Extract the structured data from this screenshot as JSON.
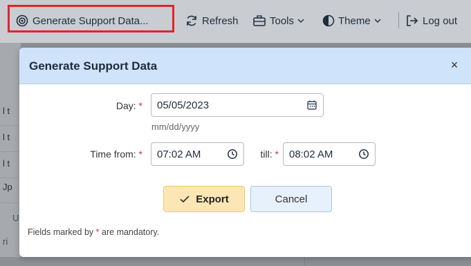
{
  "toolbar": {
    "generate_label": "Generate Support Data...",
    "refresh_label": "Refresh",
    "tools_label": "Tools",
    "theme_label": "Theme",
    "logout_label": "Log out"
  },
  "background": {
    "row_fragments": [
      "l t",
      "l t",
      "l t",
      "Jp",
      "U",
      "ri"
    ]
  },
  "dialog": {
    "title": "Generate Support Data",
    "close_glyph": "×",
    "day_label": "Day:",
    "day_value": "05/05/2023",
    "day_hint": "mm/dd/yyyy",
    "time_from_label": "Time from:",
    "time_from_value": "07:02 AM",
    "till_label": "till:",
    "till_value": "08:02 AM",
    "required_marker": "*",
    "export_label": "Export",
    "cancel_label": "Cancel",
    "footnote_prefix": "Fields marked by",
    "footnote_suffix": "are mandatory."
  },
  "colors": {
    "highlight_border": "#e0242b",
    "header_bg": "#cfe3fa",
    "export_bg": "#fce7b4",
    "cancel_bg": "#e7f1fc",
    "required": "#d6303c"
  },
  "icons": {
    "generate": "gear-cluster-icon",
    "refresh": "refresh-icon",
    "tools": "toolbox-icon",
    "theme": "contrast-icon",
    "logout": "logout-icon",
    "calendar": "calendar-icon",
    "clock": "clock-icon",
    "check": "check-icon",
    "close": "close-icon"
  }
}
